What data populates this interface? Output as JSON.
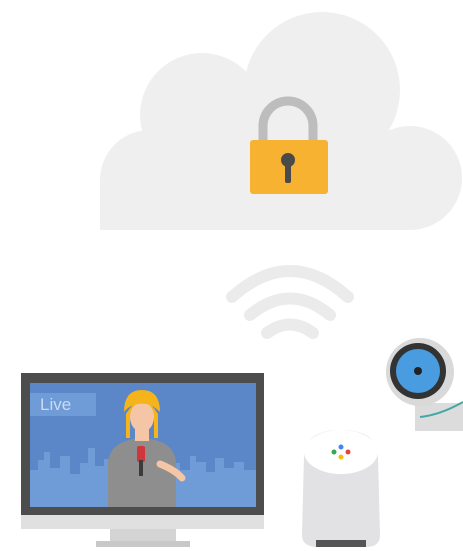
{
  "scene": {
    "tv": {
      "badge_label": "Live"
    },
    "icons": [
      "cloud-icon",
      "padlock-icon",
      "wifi-icon",
      "monitor-icon",
      "news-anchor-icon",
      "smart-speaker-icon",
      "security-camera-icon"
    ]
  },
  "colors": {
    "cloud": "#efeff0",
    "lock_body": "#f7b232",
    "lock_shackle": "#bdbdbd",
    "wifi": "#ebebec",
    "tv_screen": "#5b86c7",
    "tv_badge": "#6f9bd7",
    "speaker_body": "#e2e2e4",
    "camera_lens": "#4a9ce0"
  }
}
